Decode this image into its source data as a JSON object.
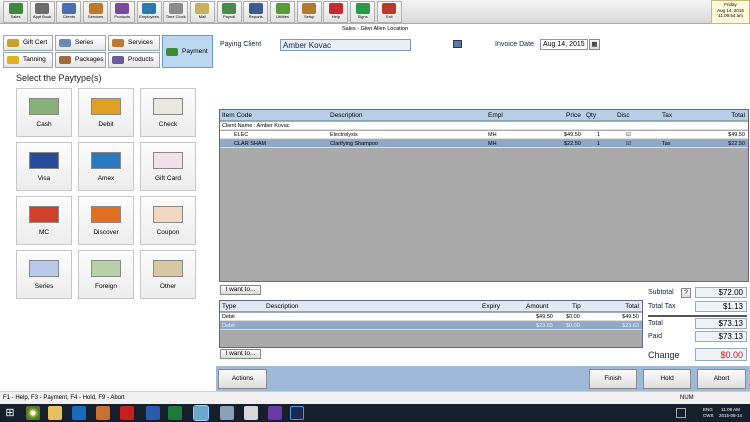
{
  "toolbar": {
    "items": [
      {
        "label": "Sales",
        "color": "#3a8a3a"
      },
      {
        "label": "Appt Book",
        "color": "#6b6b6b"
      },
      {
        "label": "Clients",
        "color": "#4a6fb0"
      },
      {
        "label": "Services",
        "color": "#c0782a"
      },
      {
        "label": "Products",
        "color": "#7a4a9a"
      },
      {
        "label": "Employees",
        "color": "#2a7ab0"
      },
      {
        "label": "Time Clock",
        "color": "#8a8a8a"
      },
      {
        "label": "Mail",
        "color": "#c8b060"
      },
      {
        "label": "Payroll",
        "color": "#4a8a4a"
      },
      {
        "label": "Reports",
        "color": "#3a5a9a"
      },
      {
        "label": "Utilities",
        "color": "#5a9a3a"
      },
      {
        "label": "Setup",
        "color": "#b07a30"
      },
      {
        "label": "Help",
        "color": "#c82a2a"
      },
      {
        "label": "Signs",
        "color": "#2a9a4a"
      },
      {
        "label": "Exit",
        "color": "#b83a2a"
      }
    ],
    "clock": {
      "day": "Friday",
      "date": "Aug 14, 2015",
      "time": "11:09:54 am"
    }
  },
  "window_title": "Sales - Glen Allen Location",
  "categories": {
    "items": [
      {
        "label": "Gift Cert",
        "color": "#c8a030"
      },
      {
        "label": "Series",
        "color": "#6a8ab0"
      },
      {
        "label": "Services",
        "color": "#c07830"
      },
      {
        "label": "Payment",
        "color": "#3a8a3a"
      },
      {
        "label": "Tanning",
        "color": "#e0b020"
      },
      {
        "label": "Packages",
        "color": "#a06a3a"
      },
      {
        "label": "Products",
        "color": "#6a5a9a"
      }
    ]
  },
  "select_title": "Select the Paytype(s)",
  "paytypes": [
    {
      "label": "Cash",
      "color": "#8ab07a"
    },
    {
      "label": "Debit",
      "color": "#e0a020"
    },
    {
      "label": "Check",
      "color": "#e8e8e0"
    },
    {
      "label": "Visa",
      "color": "#2a4a9a"
    },
    {
      "label": "Amex",
      "color": "#2a7ac0"
    },
    {
      "label": "Gift Card",
      "color": "#f0e0e8"
    },
    {
      "label": "MC",
      "color": "#d0402a"
    },
    {
      "label": "Discover",
      "color": "#e07020"
    },
    {
      "label": "Coupon",
      "color": "#f0d8c0"
    },
    {
      "label": "Series",
      "color": "#b8c8e8"
    },
    {
      "label": "Foreign",
      "color": "#b8d0a8"
    },
    {
      "label": "Other",
      "color": "#d8c8a0"
    }
  ],
  "paying_client": {
    "label": "Paying Client",
    "value": "Amber Kovac"
  },
  "invoice_date": {
    "label": "Invoice Date",
    "value": "Aug 14, 2015"
  },
  "items_table": {
    "headers": {
      "code": "Item Code",
      "desc": "Description",
      "empl": "Empl",
      "price": "Price",
      "qty": "Qty",
      "disc": "Disc",
      "tax": "Tax",
      "total": "Total"
    },
    "client_row": "Client Name : Amber Kovac",
    "rows": [
      {
        "code": "ELEC",
        "desc": "Electrolysis",
        "empl": "MH",
        "price": "$49.50",
        "qty": "1",
        "disc": "☑",
        "tax": "",
        "total": "$49.50"
      },
      {
        "code": "CLAR SHAM",
        "desc": "Clarifying Shampoo",
        "empl": "MH",
        "price": "$22.50",
        "qty": "1",
        "disc": "☑",
        "tax": "Tax",
        "total": "$22.50"
      }
    ],
    "i_want_to": "I want to..."
  },
  "payments_table": {
    "headers": {
      "type": "Type",
      "desc": "Description",
      "expiry": "Expiry",
      "amount": "Amount",
      "tip": "Tip",
      "total": "Total"
    },
    "rows": [
      {
        "type": "Debit",
        "desc": "",
        "expiry": "",
        "amount": "$49.50",
        "tip": "$0.00",
        "total": "$49.50"
      },
      {
        "type": "Debit",
        "desc": "",
        "expiry": "",
        "amount": "$23.63",
        "tip": "$0.00",
        "total": "$23.63"
      }
    ],
    "i_want_to": "I want to..."
  },
  "totals": {
    "subtotal_label": "Subtotal",
    "help": "?",
    "subtotal": "$72.00",
    "tax_label": "Total Tax",
    "tax": "$1.13",
    "total_label": "Total",
    "total": "$73.13",
    "paid_label": "Paid",
    "paid": "$73.13",
    "change_label": "Change",
    "change": "$0.00",
    "change_color": "#d01818"
  },
  "actions": {
    "actions": "Actions",
    "finish": "Finish",
    "hold": "Hold",
    "abort": "Abort"
  },
  "status": {
    "hint": "F1 - Help, F3 - Payment, F4 - Hold, F9 - Abort",
    "num": "NUM"
  },
  "taskbar": {
    "lang": "ENG",
    "region": "CWS",
    "time": "11:09 AM",
    "date": "2015-08-14"
  }
}
